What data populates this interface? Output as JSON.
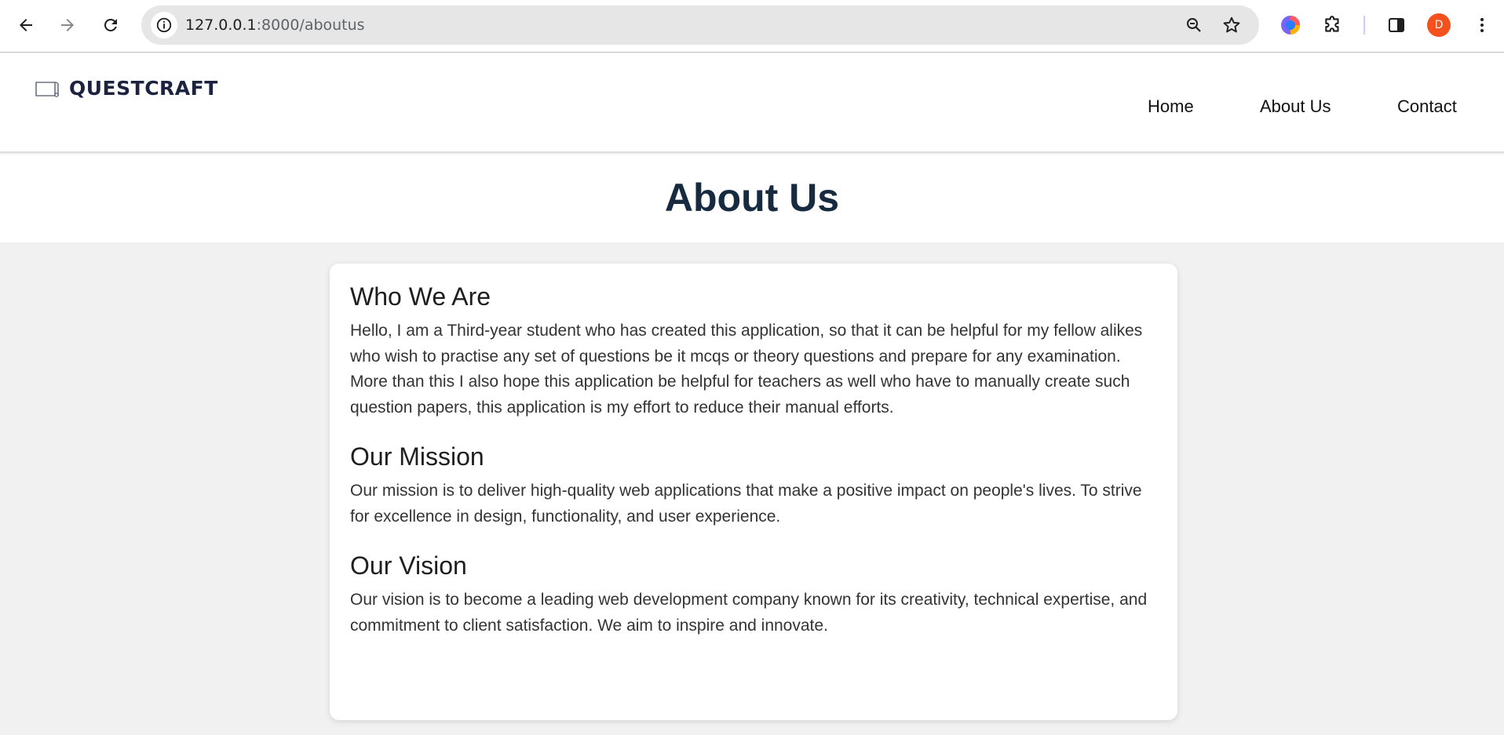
{
  "browser": {
    "url_host": "127.0.0.1",
    "url_path": ":8000/aboutus",
    "profile_initial": "D",
    "icons": [
      "back-arrow-icon",
      "forward-arrow-icon",
      "reload-icon",
      "site-info-icon",
      "zoom-icon",
      "bookmark-star-icon",
      "extension-colorful-icon",
      "puzzle-icon",
      "side-panel-icon",
      "more-vert-icon"
    ],
    "colors": {
      "avatar": "#f4511e",
      "omnibox": "#e6e6e6"
    }
  },
  "site": {
    "logo_text": "QUESTCRAFT",
    "nav": [
      {
        "label": "Home"
      },
      {
        "label": "About Us"
      },
      {
        "label": "Contact"
      }
    ]
  },
  "page": {
    "title": "About Us",
    "sections": [
      {
        "heading": "Who We Are",
        "body": "Hello, I am a Third-year student who has created this application, so that it can be helpful for my fellow alikes who wish to practise any set of questions be it mcqs or theory questions and prepare for any examination. More than this I also hope this application be helpful for teachers as well who have to manually create such question papers, this application is my effort to reduce their manual efforts."
      },
      {
        "heading": "Our Mission",
        "body": "Our mission is to deliver high-quality web applications that make a positive impact on people's lives. To strive for excellence in design, functionality, and user experience."
      },
      {
        "heading": "Our Vision",
        "body": "Our vision is to become a leading web development company known for its creativity, technical expertise, and commitment to client satisfaction. We aim to inspire and innovate."
      }
    ]
  }
}
